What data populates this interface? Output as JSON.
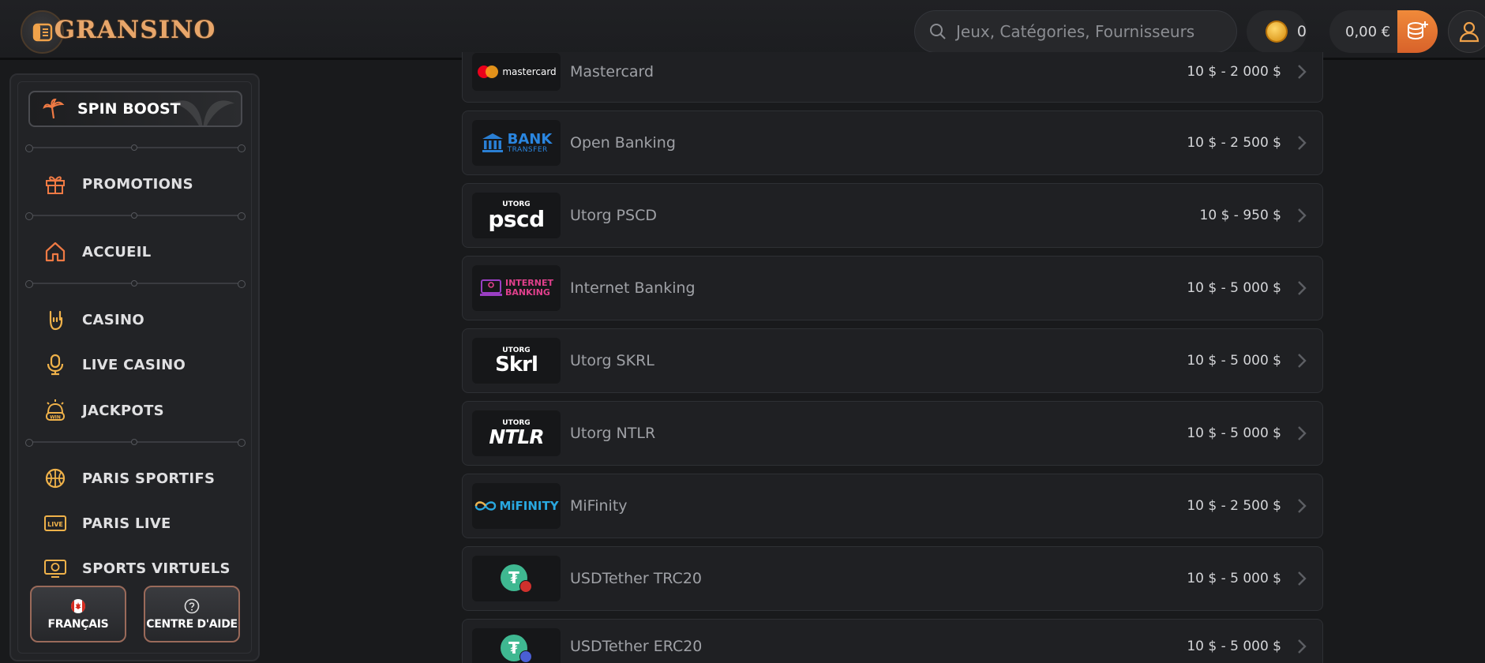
{
  "header": {
    "logo_text": "GRANSINO",
    "search_placeholder": "Jeux, Catégories, Fournisseurs",
    "coins": "0",
    "balance": "0,00 €"
  },
  "sidebar": {
    "spin_boost": "SPIN BOOST",
    "promotions": "PROMOTIONS",
    "home": "ACCUEIL",
    "casino": "CASINO",
    "live_casino": "LIVE CASINO",
    "jackpots": "JACKPOTS",
    "sports": "PARIS SPORTIFS",
    "live_bets": "PARIS LIVE",
    "virtual_sports": "SPORTS VIRTUELS",
    "language": "FRANÇAIS",
    "help": "CENTRE D'AIDE"
  },
  "methods": [
    {
      "name": "Mastercard",
      "range": "10 $ - 2 000 $",
      "logo": "mastercard"
    },
    {
      "name": "Open Banking",
      "range": "10 $ - 2 500 $",
      "logo": "bank-transfer"
    },
    {
      "name": "Utorg PSCD",
      "range": "10 $ - 950 $",
      "logo": "pscd"
    },
    {
      "name": "Internet Banking",
      "range": "10 $ - 5 000 $",
      "logo": "internet-banking"
    },
    {
      "name": "Utorg SKRL",
      "range": "10 $ - 5 000 $",
      "logo": "skrl"
    },
    {
      "name": "Utorg NTLR",
      "range": "10 $ - 5 000 $",
      "logo": "ntlr"
    },
    {
      "name": "MiFinity",
      "range": "10 $ - 2 500 $",
      "logo": "mifinity"
    },
    {
      "name": "USDTether TRC20",
      "range": "10 $ - 5 000 $",
      "logo": "tether-trc20"
    },
    {
      "name": "USDTether ERC20",
      "range": "10 $ - 5 000 $",
      "logo": "tether-erc20"
    }
  ],
  "logo_labels": {
    "mastercard": "mastercard",
    "bank_1": "BANK",
    "bank_2": "TRANSFER",
    "utorg": "UTORG",
    "pscd": "pscd",
    "internet_1": "INTERNET",
    "internet_2": "BANKING",
    "skrl": "Skrl",
    "ntlr": "NTLR",
    "mifinity": "MiFINITY",
    "tether": "₮"
  },
  "colors": {
    "accent_orange": "#e8803a",
    "gold": "#e8a66a",
    "background": "#191a1c"
  }
}
